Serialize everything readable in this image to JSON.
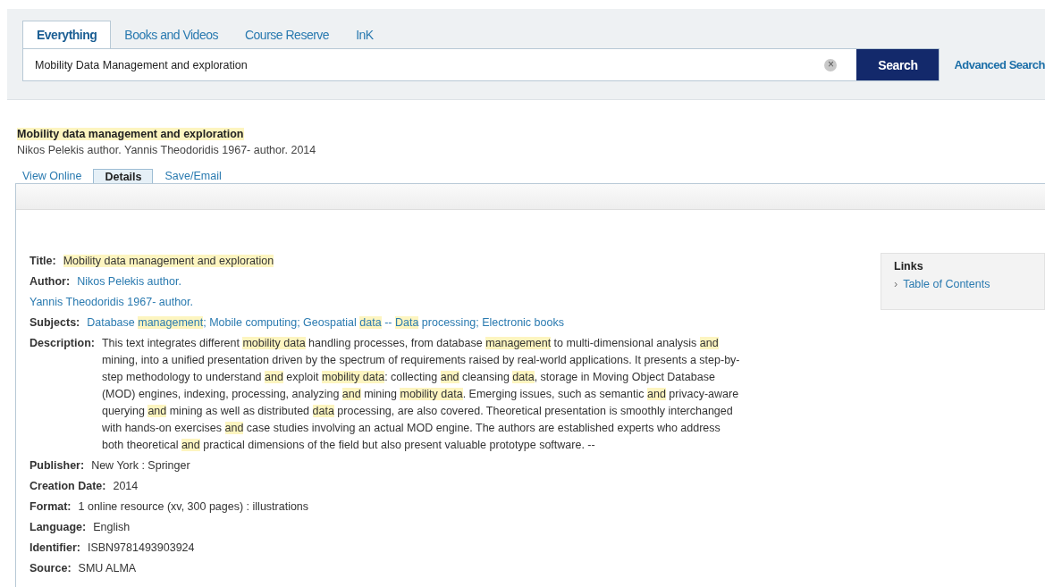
{
  "search_tabs": [
    {
      "label": "Everything",
      "selected": true
    },
    {
      "label": "Books and Videos",
      "selected": false
    },
    {
      "label": "Course Reserve",
      "selected": false
    },
    {
      "label": "InK",
      "selected": false
    }
  ],
  "search": {
    "value": "Mobility Data Management and exploration",
    "clear": "×",
    "button": "Search",
    "advanced": "Advanced Search"
  },
  "result": {
    "title": [
      {
        "text": "Mobility data management and exploration",
        "highlight": true
      }
    ],
    "byline": "Nikos Pelekis author. Yannis Theodoridis 1967- author. 2014"
  },
  "detail_tabs": [
    {
      "label": "View Online",
      "selected": false
    },
    {
      "label": "Details",
      "selected": true
    },
    {
      "label": "Save/Email",
      "selected": false
    }
  ],
  "fields": [
    {
      "label": "Title:",
      "kind": "text",
      "values": [
        [
          {
            "text": "Mobility data management and exploration",
            "highlight": true
          }
        ]
      ]
    },
    {
      "label": "Author:",
      "kind": "link",
      "values": [
        [
          {
            "text": "Nikos Pelekis author.",
            "highlight": false
          }
        ]
      ]
    },
    {
      "kind": "link",
      "values": [
        [
          {
            "text": "Yannis Theodoridis 1967- author.",
            "highlight": false
          }
        ]
      ]
    },
    {
      "label": "Subjects:",
      "kind": "link",
      "values": [
        [
          {
            "text": "Database ",
            "highlight": false
          },
          {
            "text": "management",
            "highlight": true
          },
          {
            "text": "; ",
            "highlight": false
          }
        ],
        [
          {
            "text": "Mobile computing; ",
            "highlight": false
          }
        ],
        [
          {
            "text": "Geospatial ",
            "highlight": false
          },
          {
            "text": "data",
            "highlight": true
          },
          {
            "text": " -- ",
            "highlight": false
          },
          {
            "text": "Data",
            "highlight": true
          },
          {
            "text": " processing; ",
            "highlight": false
          }
        ],
        [
          {
            "text": "Electronic books",
            "highlight": false
          }
        ]
      ]
    },
    {
      "label": "Description:",
      "kind": "text",
      "values": [
        [
          {
            "text": "This text integrates different ",
            "highlight": false
          },
          {
            "text": "mobility data",
            "highlight": true
          },
          {
            "text": " handling processes, from database ",
            "highlight": false
          },
          {
            "text": "management",
            "highlight": true
          },
          {
            "text": " to multi-dimensional analysis ",
            "highlight": false
          },
          {
            "text": "and",
            "highlight": true
          },
          {
            "text": " mining, into a unified presentation driven by the spectrum of requirements raised by real-world applications. It presents a step-by-step methodology to understand ",
            "highlight": false
          },
          {
            "text": "and",
            "highlight": true
          },
          {
            "text": " exploit ",
            "highlight": false
          },
          {
            "text": "mobility data",
            "highlight": true
          },
          {
            "text": ": collecting ",
            "highlight": false
          },
          {
            "text": "and",
            "highlight": true
          },
          {
            "text": " cleansing ",
            "highlight": false
          },
          {
            "text": "data",
            "highlight": true
          },
          {
            "text": ", storage in Moving Object Database (MOD) engines, indexing, processing, analyzing ",
            "highlight": false
          },
          {
            "text": "and",
            "highlight": true
          },
          {
            "text": " mining ",
            "highlight": false
          },
          {
            "text": "mobility data",
            "highlight": true
          },
          {
            "text": ". Emerging issues, such as semantic ",
            "highlight": false
          },
          {
            "text": "and",
            "highlight": true
          },
          {
            "text": " privacy-aware querying ",
            "highlight": false
          },
          {
            "text": "and",
            "highlight": true
          },
          {
            "text": " mining as well as distributed ",
            "highlight": false
          },
          {
            "text": "data",
            "highlight": true
          },
          {
            "text": " processing, are also covered. Theoretical presentation is smoothly interchanged with hands-on exercises ",
            "highlight": false
          },
          {
            "text": "and",
            "highlight": true
          },
          {
            "text": " case studies involving an actual MOD engine. The authors are established experts who address both theoretical ",
            "highlight": false
          },
          {
            "text": "and",
            "highlight": true
          },
          {
            "text": " practical dimensions of the field but also present valuable prototype software. --",
            "highlight": false
          }
        ]
      ]
    },
    {
      "label": "Publisher:",
      "kind": "text",
      "values": [
        [
          {
            "text": "New York : Springer",
            "highlight": false
          }
        ]
      ]
    },
    {
      "label": "Creation Date:",
      "kind": "text",
      "values": [
        [
          {
            "text": "2014",
            "highlight": false
          }
        ]
      ]
    },
    {
      "label": "Format:",
      "kind": "text",
      "values": [
        [
          {
            "text": "1 online resource (xv, 300 pages) : illustrations",
            "highlight": false
          }
        ]
      ]
    },
    {
      "label": "Language:",
      "kind": "text",
      "values": [
        [
          {
            "text": "English",
            "highlight": false
          }
        ]
      ]
    },
    {
      "label": "Identifier:",
      "kind": "text",
      "values": [
        [
          {
            "text": "ISBN9781493903924",
            "highlight": false
          }
        ]
      ]
    },
    {
      "label": "Source:",
      "kind": "text",
      "values": [
        [
          {
            "text": "SMU ALMA",
            "highlight": false
          }
        ]
      ]
    }
  ],
  "links": {
    "title": "Links",
    "items": [
      {
        "marker": "›",
        "label": "Table of Contents"
      }
    ]
  }
}
